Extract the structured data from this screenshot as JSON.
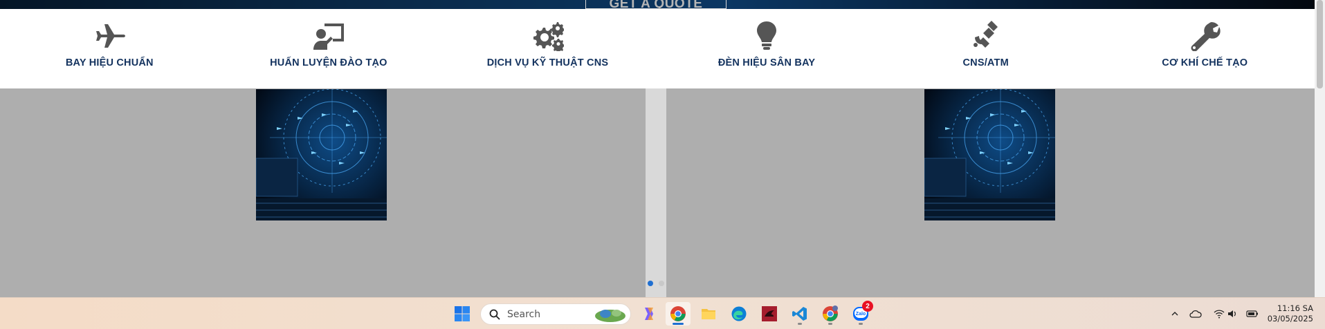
{
  "hero": {
    "cta_label": "GET A QUOTE"
  },
  "services": [
    {
      "label": "BAY HIỆU CHUẨN",
      "icon": "plane-icon"
    },
    {
      "label": "HUẤN LUYỆN ĐÀO TẠO",
      "icon": "teacher-icon"
    },
    {
      "label": "DỊCH VỤ KỸ THUẬT CNS",
      "icon": "gears-icon"
    },
    {
      "label": "ĐÈN HIỆU SÂN BAY",
      "icon": "lightbulb-icon"
    },
    {
      "label": "CNS/ATM",
      "icon": "satellite-icon"
    },
    {
      "label": "CƠ KHÍ CHẾ TẠO",
      "icon": "wrench-icon"
    }
  ],
  "slider": {
    "total_dots": 2,
    "active_dot": 0
  },
  "taskbar": {
    "search_placeholder": "Search",
    "zalo_badge": "2",
    "clock_time": "11:16 SA",
    "clock_date": "03/05/2025",
    "apps": [
      "windows-start-icon",
      "copilot-icon",
      "chrome-icon",
      "file-explorer-icon",
      "edge-icon",
      "red-app-icon",
      "vscode-icon",
      "chrome-profile-icon",
      "zalo-icon"
    ]
  },
  "colors": {
    "label_navy": "#13325e",
    "icon_gray": "#555555",
    "accent_blue": "#1f6fd1"
  }
}
